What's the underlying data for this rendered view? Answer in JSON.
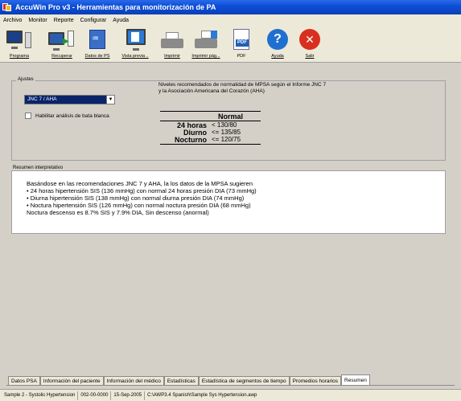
{
  "window": {
    "title": "AccuWin Pro v3 - Herramientas para monitorización de PA"
  },
  "menu": [
    "Archivo",
    "Monitor",
    "Reporte",
    "Configurar",
    "Ayuda"
  ],
  "toolbar": {
    "programa": "Programa",
    "recuperar": "Recuperar",
    "datos_ps": "Datos de PS",
    "vista_previa": "Vista previa ..",
    "imprimir": "Imprimir",
    "imprimir_pag": "Imprimir pág...",
    "pdf": "PDF",
    "ayuda": "Ayuda",
    "salir": "Salir"
  },
  "ajustes": {
    "title": "Ajustes",
    "selected_standard": "JNC 7 / AHA",
    "white_coat_label": "Habilitar análisis de bata blanca",
    "rec_line1": "Niveles recomendados de normalidad de MPSA según el Informe JNC 7",
    "rec_line2": "y la Asociación Americana del Corazón (AHA)",
    "table_header": "Normal",
    "rows": [
      {
        "label": "24 horas",
        "value": "< 130/80"
      },
      {
        "label": "Diurno",
        "value": "<= 135/85"
      },
      {
        "label": "Nocturno",
        "value": "<= 120/75"
      }
    ]
  },
  "resumen": {
    "title": "Resumen interpretativo",
    "lines": [
      "Basándose en las recomendaciones JNC 7 y AHA, la los datos de la MPSA sugieren",
      "• 24 horas hipertensión SIS (136 mmHg) con normal 24 horas presión DIA (73 mmHg)",
      "• Diurna hipertensión SIS (138 mmHg) con normal diurna presión DIA (74 mmHg)",
      "• Noctura hipertensión SIS (126 mmHg) con normal noctura presión DIA (68 mmHg)",
      "Noctura descenso es 8.7% SIS y 7.9% DIA, Sin descenso (anormal)"
    ]
  },
  "tabs": [
    "Datos PSA",
    "Información del paciente",
    "Información del médico",
    "Estadísticas",
    "Estadística de segmentos de tiempo",
    "Promedios horarios",
    "Resumen"
  ],
  "active_tab": "Resumen",
  "status": {
    "sample": "Sample 2 - Systolic Hypertension",
    "id": "002-00-0000",
    "date": "15-Sep-2005",
    "path": "C:\\AWP3.4 Spanish\\Sample Sys Hypertension.awp"
  },
  "colors": {
    "titlebar": "#0d4fd8",
    "selection": "#0a246a",
    "help": "#1f6fd0",
    "exit": "#d83020"
  }
}
